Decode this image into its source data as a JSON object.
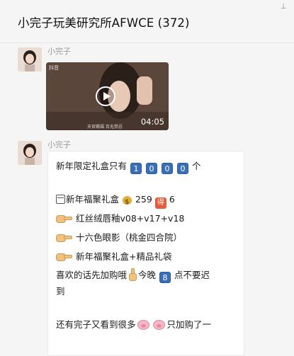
{
  "header": {
    "title": "小完子玩美研究所AFWCE (372)",
    "pin_icon": "pin-icon"
  },
  "messages": [
    {
      "sender": "小完子",
      "type": "video",
      "video": {
        "watermark": "抖音",
        "caption": "天官赐福 百无禁忌",
        "duration": "04:05"
      }
    },
    {
      "sender": "小完子",
      "type": "text",
      "lines": {
        "l1_a": "新年限定礼盒只有",
        "l1_digits": [
          "1",
          "0",
          "0",
          "0"
        ],
        "l1_b": "个",
        "l2_a": "新年福聚礼盒",
        "l2_price": "259",
        "l2_de": "得",
        "l2_num": "6",
        "l3": "红丝绒唇釉v08+v17+v18",
        "l4": "十六色眼影（桃金四合院）",
        "l5": "新年福聚礼盒+精品礼袋",
        "l6_a": "喜欢的话先加购哦",
        "l6_b": "今晚",
        "l6_num": "8",
        "l6_c": "点不要迟",
        "l7": "到",
        "l8_a": "还有完子又看到很多",
        "l8_b": "只加购了一"
      }
    }
  ]
}
